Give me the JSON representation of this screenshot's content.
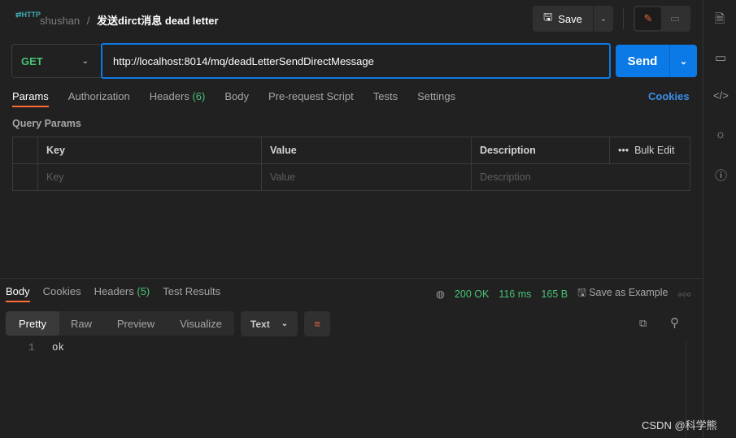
{
  "header": {
    "workspace": "shushan",
    "separator": "/",
    "request_name": "发送dirct消息 dead letter",
    "save_label": "Save"
  },
  "request": {
    "method": "GET",
    "url": "http://localhost:8014/mq/deadLetterSendDirectMessage",
    "send_label": "Send"
  },
  "request_tabs": [
    {
      "label": "Params"
    },
    {
      "label": "Authorization"
    },
    {
      "label": "Headers",
      "count": "(6)"
    },
    {
      "label": "Body"
    },
    {
      "label": "Pre-request Script"
    },
    {
      "label": "Tests"
    },
    {
      "label": "Settings"
    }
  ],
  "cookies_link": "Cookies",
  "query_params": {
    "title": "Query Params",
    "columns": [
      "Key",
      "Value",
      "Description"
    ],
    "bulk_edit": "Bulk Edit",
    "placeholders": [
      "Key",
      "Value",
      "Description"
    ]
  },
  "response": {
    "tabs": [
      {
        "label": "Body"
      },
      {
        "label": "Cookies"
      },
      {
        "label": "Headers",
        "count": "(5)"
      },
      {
        "label": "Test Results"
      }
    ],
    "status": "200 OK",
    "time": "116 ms",
    "size": "165 B",
    "save_example": "Save as Example",
    "views": [
      "Pretty",
      "Raw",
      "Preview",
      "Visualize"
    ],
    "format": "Text",
    "lines": [
      {
        "n": "1",
        "text": "ok"
      }
    ]
  },
  "watermark": "CSDN @科学熊",
  "colors": {
    "accent": "#0c7ae6",
    "active_tab": "#ff6c37",
    "success": "#49c275"
  }
}
